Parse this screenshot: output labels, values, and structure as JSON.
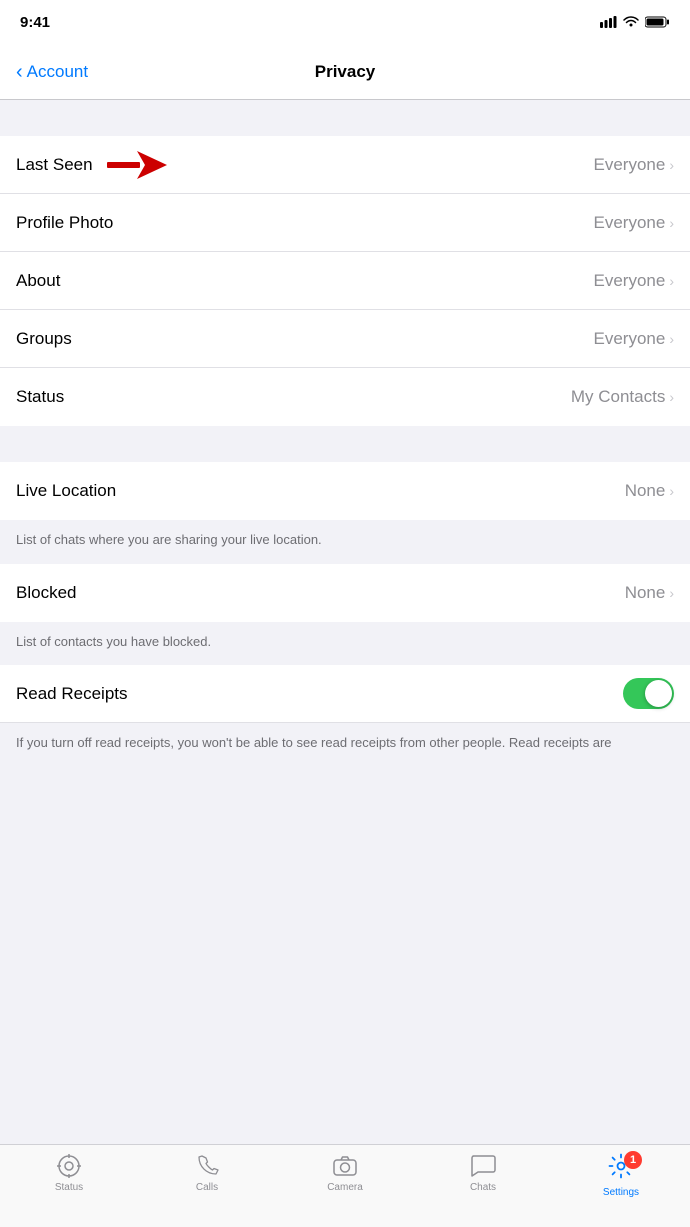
{
  "statusBar": {
    "time": "9:41"
  },
  "navBar": {
    "backLabel": "Account",
    "title": "Privacy"
  },
  "privacyRows": [
    {
      "id": "last-seen",
      "label": "Last Seen",
      "value": "Everyone",
      "hasArrow": true,
      "annotated": true
    },
    {
      "id": "profile-photo",
      "label": "Profile Photo",
      "value": "Everyone",
      "hasArrow": true,
      "annotated": false
    },
    {
      "id": "about",
      "label": "About",
      "value": "Everyone",
      "hasArrow": true,
      "annotated": false
    },
    {
      "id": "groups",
      "label": "Groups",
      "value": "Everyone",
      "hasArrow": true,
      "annotated": false
    },
    {
      "id": "status",
      "label": "Status",
      "value": "My Contacts",
      "hasArrow": true,
      "annotated": false
    }
  ],
  "liveLocation": {
    "label": "Live Location",
    "value": "None",
    "info": "List of chats where you are sharing your live location."
  },
  "blocked": {
    "label": "Blocked",
    "value": "None",
    "info": "List of contacts you have blocked."
  },
  "readReceipts": {
    "label": "Read Receipts",
    "enabled": true,
    "info": "If you turn off read receipts, you won't be able to see read receipts from other people. Read receipts are"
  },
  "tabBar": {
    "items": [
      {
        "id": "status",
        "label": "Status",
        "icon": "⊙",
        "active": false
      },
      {
        "id": "calls",
        "label": "Calls",
        "icon": "✆",
        "active": false
      },
      {
        "id": "camera",
        "label": "Camera",
        "icon": "⊚",
        "active": false
      },
      {
        "id": "chats",
        "label": "Chats",
        "icon": "💬",
        "active": false
      },
      {
        "id": "settings",
        "label": "Settings",
        "icon": "⚙",
        "active": true,
        "badge": "1"
      }
    ]
  }
}
